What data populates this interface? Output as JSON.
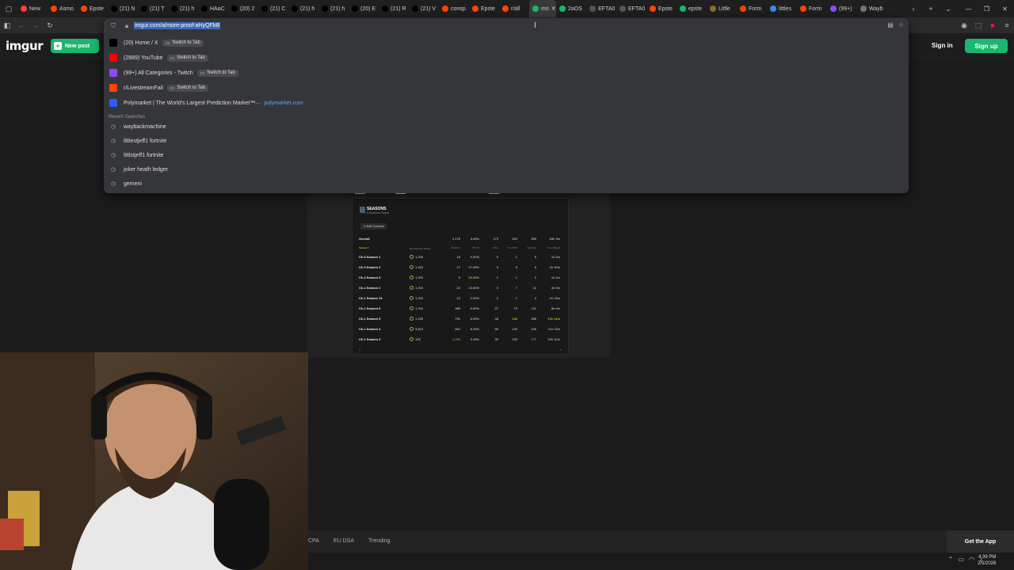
{
  "browser": {
    "tabs": [
      {
        "label": "New",
        "icon": "youtube-icon",
        "color": "#ff3d3d"
      },
      {
        "label": "Asmo",
        "icon": "reddit-icon",
        "color": "#ff4500"
      },
      {
        "label": "Epste",
        "icon": "reddit-icon",
        "color": "#ff4500"
      },
      {
        "label": "(21) N",
        "icon": "x-icon",
        "color": "#000000"
      },
      {
        "label": "(21) T",
        "icon": "x-icon",
        "color": "#000000"
      },
      {
        "label": "(21) h",
        "icon": "x-icon",
        "color": "#000000"
      },
      {
        "label": "HAaC",
        "icon": "x-icon",
        "color": "#000000"
      },
      {
        "label": "(20) 2",
        "icon": "x-icon",
        "color": "#000000"
      },
      {
        "label": "(21) C",
        "icon": "x-icon",
        "color": "#000000"
      },
      {
        "label": "(21) h",
        "icon": "x-icon",
        "color": "#000000"
      },
      {
        "label": "(21) h",
        "icon": "x-icon",
        "color": "#000000"
      },
      {
        "label": "(20) E",
        "icon": "x-icon",
        "color": "#000000"
      },
      {
        "label": "(21) R",
        "icon": "x-icon",
        "color": "#000000"
      },
      {
        "label": "(21) V",
        "icon": "x-icon",
        "color": "#000000"
      },
      {
        "label": "consp",
        "icon": "reddit-icon",
        "color": "#ff4500"
      },
      {
        "label": "Epste",
        "icon": "reddit-icon",
        "color": "#ff4500"
      },
      {
        "label": "r/all",
        "icon": "reddit-icon",
        "color": "#ff4500"
      },
      {
        "label": "mo",
        "icon": "imgur-icon",
        "color": "#1bb76e",
        "active": true
      },
      {
        "label": "2aOS",
        "icon": "imgur-icon",
        "color": "#1bb76e"
      },
      {
        "label": "EFTA0",
        "icon": "doc-icon",
        "color": "#555555"
      },
      {
        "label": "EFTA0",
        "icon": "doc-icon",
        "color": "#555555"
      },
      {
        "label": "Epste",
        "icon": "reddit-icon",
        "color": "#ff4500"
      },
      {
        "label": "epste",
        "icon": "imgur-icon",
        "color": "#1bb76e"
      },
      {
        "label": "Little",
        "icon": "fortnite-icon",
        "color": "#8a6a2a"
      },
      {
        "label": "Fortn",
        "icon": "reddit-icon",
        "color": "#ff4500"
      },
      {
        "label": "littles",
        "icon": "google-icon",
        "color": "#4285f4"
      },
      {
        "label": "Fortn",
        "icon": "reddit-icon",
        "color": "#ff4500"
      },
      {
        "label": "(99+)",
        "icon": "twitch-icon",
        "color": "#9146ff"
      },
      {
        "label": "Wayb",
        "icon": "archive-icon",
        "color": "#777777"
      }
    ],
    "address": {
      "url": "imgur.com/a/more-proof-aHyQFbB"
    }
  },
  "omnibox": {
    "suggestions": [
      {
        "icon": "x-icon",
        "title": "(20) Home / X",
        "switch": "Switch to Tab",
        "color": "#000000"
      },
      {
        "icon": "youtube-icon",
        "title": "(2889) YouTube",
        "switch": "Switch to Tab",
        "color": "#ff0000"
      },
      {
        "icon": "twitch-icon",
        "title": "(99+) All Categories - Twitch",
        "switch": "Switch to Tab",
        "color": "#9146ff"
      },
      {
        "icon": "reddit-icon",
        "title": "r/LivestreamFail",
        "switch": "Switch to Tab",
        "color": "#ff4500"
      },
      {
        "icon": "polymarket-icon",
        "title": "Polymarket | The World's Largest Prediction Market™",
        "url": "polymarket.com",
        "color": "#2d5bff"
      }
    ],
    "recent_heading": "Recent Searches",
    "recent": [
      "waybackmachine",
      "littlestjeff1 fortnite",
      "littlstjeff1 fortnite",
      "joker heath ledger",
      "gemeni"
    ]
  },
  "imgur": {
    "logo": "imgur",
    "new_post": "New post",
    "sign_in": "Sign in",
    "sign_up": "Sign up",
    "brand_color": "#1bb76e"
  },
  "stats_card": {
    "title": "SEASONS",
    "subtitle": "9 Seasons Played",
    "edit_columns": "Edit Columns",
    "overall": {
      "label": "Overall",
      "matches": "2,176",
      "win_pct": "3.45%",
      "wins": "173",
      "top3_4_5": "494",
      "top10": "955",
      "time": "53h 9m"
    },
    "headers": {
      "season": "Season ▾",
      "rating": "Best Ranked Rating",
      "matches": "Matches",
      "win_pct": "Win %",
      "wins": "Wins",
      "top3": "Top 3/4/5",
      "top10": "Top 6/10",
      "time": "Time Played"
    },
    "rows": [
      {
        "season": "Ch.6 Season 1",
        "rating": "1,205",
        "matches": "16",
        "win_pct": "0.00%",
        "wins": "0",
        "top3": "1",
        "top10": "5",
        "time": "1h 3m"
      },
      {
        "season": "Ch.3 Season 2",
        "rating": "1,433",
        "matches": "17",
        "win_pct": "17.65%",
        "wins": "3",
        "top3": "5",
        "top10": "5",
        "time": "2h 30m"
      },
      {
        "season": "Ch.2 Season 5",
        "rating": "1,200",
        "matches": "5",
        "win_pct": "20.00%",
        "wins": "1",
        "top3": "1",
        "top10": "2",
        "time": "1h 4m"
      },
      {
        "season": "Ch.2 Season 1",
        "rating": "1,200",
        "matches": "22",
        "win_pct": "13.64%",
        "wins": "3",
        "top3": "7",
        "top10": "11",
        "time": "4h 0m"
      },
      {
        "season": "Ch.1 Season 10",
        "rating": "1,200",
        "matches": "12",
        "win_pct": "0.00%",
        "wins": "0",
        "top3": "1",
        "top10": "4",
        "time": "1h 15m"
      },
      {
        "season": "Ch.1 Season 6",
        "rating": "1,244",
        "matches": "489",
        "win_pct": "5.50%",
        "wins": "27",
        "top3": "73",
        "top10": "131",
        "time": "8h 9m"
      },
      {
        "season": "Ch.1 Season 5",
        "rating": "1,190",
        "matches": "794",
        "win_pct": "6.05%",
        "wins": "48",
        "top3": "146",
        "top10": "286",
        "time": "13h 14m"
      },
      {
        "season": "Ch.1 Season 4",
        "rating": "3,619",
        "matches": "662",
        "win_pct": "8.28%",
        "wins": "56",
        "top3": "125",
        "top10": "236",
        "time": "11h 23m"
      },
      {
        "season": "Ch.1 Season 3",
        "rating": "126",
        "matches": "1,159",
        "win_pct": "3.16%",
        "wins": "35",
        "top3": "133",
        "top10": "272",
        "time": "10h 12m"
      }
    ]
  },
  "footer": {
    "links": [
      "CPA",
      "EU DSA",
      "Trending"
    ],
    "get_app": "Get the App"
  },
  "taskbar": {
    "time": "4:39 PM",
    "date": "2/5/2026"
  }
}
